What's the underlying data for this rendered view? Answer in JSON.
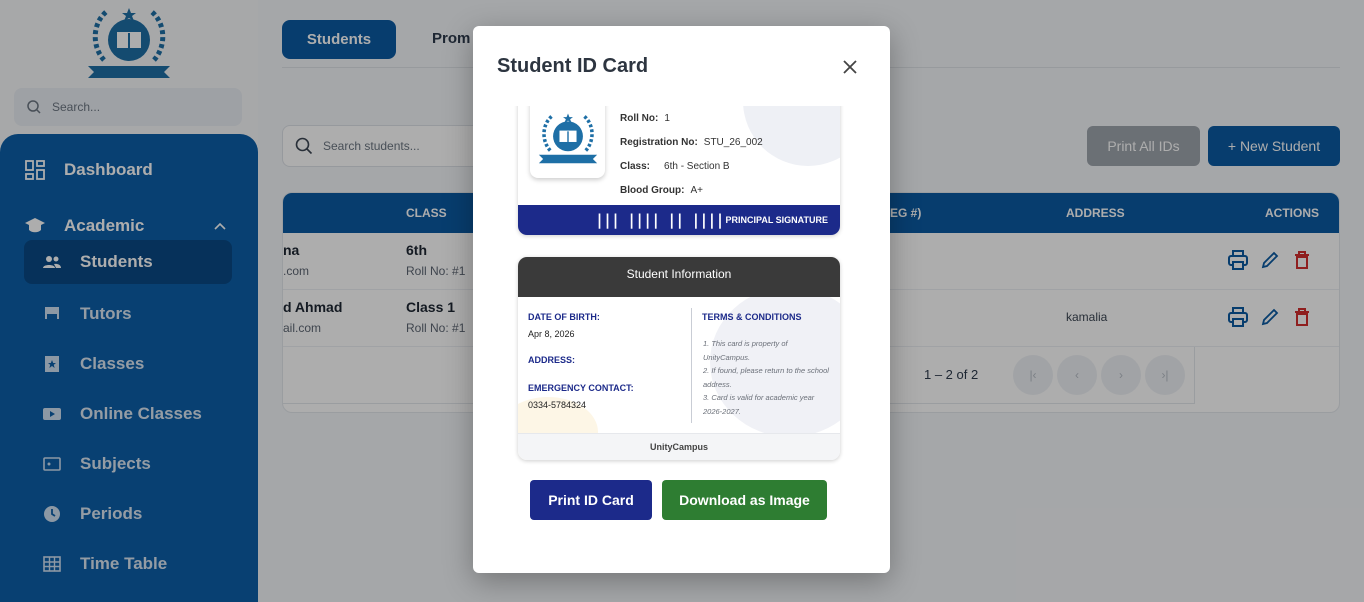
{
  "sidebar": {
    "search_placeholder": "Search...",
    "items": [
      {
        "label": "Dashboard",
        "icon": "dashboard-icon"
      },
      {
        "label": "Academic",
        "icon": "graduation-cap-icon"
      },
      {
        "label": "Students",
        "icon": "people-icon"
      },
      {
        "label": "Tutors",
        "icon": "tutor-icon"
      },
      {
        "label": "Classes",
        "icon": "classes-icon"
      },
      {
        "label": "Online Classes",
        "icon": "video-icon"
      },
      {
        "label": "Subjects",
        "icon": "subject-icon"
      },
      {
        "label": "Periods",
        "icon": "clock-icon"
      },
      {
        "label": "Time Table",
        "icon": "grid-icon"
      }
    ]
  },
  "tabs": {
    "students": "Students",
    "promotions": "Prom"
  },
  "toolbar": {
    "search_placeholder": "Search students...",
    "print_all": "Print All IDs",
    "new_student": "+ New Student"
  },
  "table": {
    "headers": {
      "class": "CLASS",
      "reg": "EG #)",
      "address": "ADDRESS",
      "actions": "ACTIONS"
    },
    "rows": [
      {
        "name": "na",
        "email": ".com",
        "class": "6th",
        "roll": "Roll No: #1",
        "address": ""
      },
      {
        "name": "d Ahmad",
        "email": "ail.com",
        "class": "Class 1",
        "roll": "Roll No: #1",
        "address": "kamalia"
      }
    ],
    "range": "1 – 2 of 2"
  },
  "modal": {
    "title": "Student ID Card",
    "front": {
      "roll_label": "Roll No:",
      "roll_value": "1",
      "reg_label": "Registration No:",
      "reg_value": "STU_26_002",
      "class_label": "Class:",
      "class_value": "6th - Section B",
      "blood_label": "Blood Group:",
      "blood_value": "A+",
      "barcode": "||| |||| || ||||",
      "signature": "PRINCIPAL SIGNATURE"
    },
    "back": {
      "heading": "Student Information",
      "dob_label": "DATE OF BIRTH:",
      "dob_value": "Apr 8, 2026",
      "address_label": "ADDRESS:",
      "emergency_label": "EMERGENCY CONTACT:",
      "emergency_value": "0334-5784324",
      "terms_title": "TERMS & CONDITIONS",
      "terms": [
        "1. This card is property of UnityCampus.",
        "2. If found, please return to the school address.",
        "3. Card is valid for academic year 2026-2027."
      ],
      "footer": "UnityCampus"
    },
    "print_button": "Print ID Card",
    "download_button": "Download as Image"
  },
  "colors": {
    "primary": "#0b5aa2",
    "navy": "#1c2a8a",
    "green": "#2e7d32",
    "danger": "#d32f2f"
  }
}
